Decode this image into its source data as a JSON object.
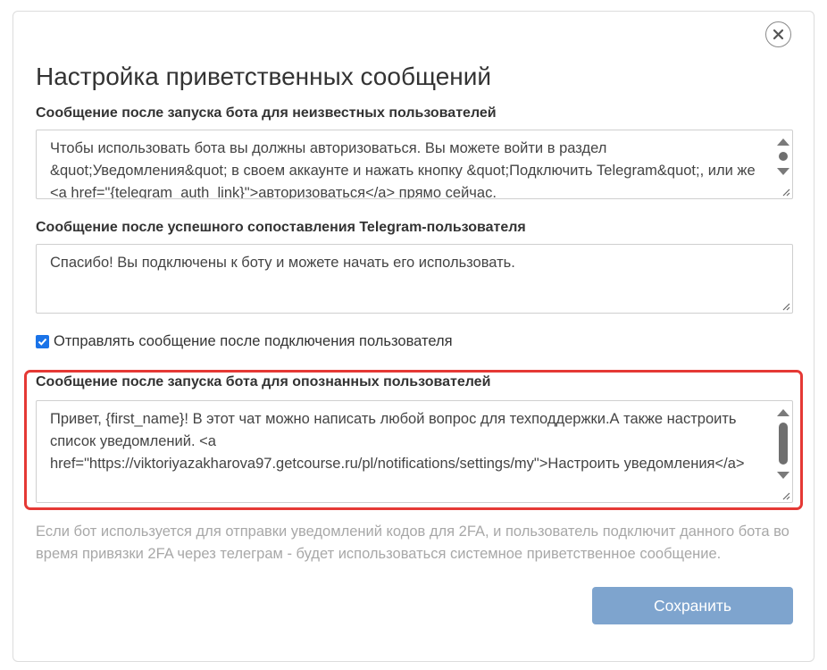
{
  "dialog": {
    "title": "Настройка приветственных сообщений",
    "close_icon": "close-icon"
  },
  "unknown_users": {
    "label": "Сообщение после запуска бота для неизвестных пользователей",
    "value": "Чтобы использовать бота вы должны авторизоваться. Вы можете войти в раздел &quot;Уведомления&quot; в своем аккаунте и нажать кнопку &quot;Подключить Telegram&quot;, или же <a href=\"{telegram_auth_link}\">авторизоваться</a> прямо сейчас."
  },
  "success_match": {
    "label": "Сообщение после успешного сопоставления Telegram-пользователя",
    "value": "Спасибо! Вы подключены к боту и можете начать его использовать."
  },
  "send_after_connect": {
    "checked": true,
    "label": "Отправлять сообщение после подключения пользователя"
  },
  "known_users": {
    "label": "Сообщение после запуска бота для опознанных пользователей",
    "value": "Привет, {first_name}! В этот чат можно написать любой вопрос для техподдержки.А также настроить список уведомлений. <a href=\"https://viktoriyazakharova97.getcourse.ru/pl/notifications/settings/my\">Настроить уведомления</a>"
  },
  "hint": "Если бот используется для отправки уведомлений кодов для 2FA, и пользователь подключит данного бота во время привязки 2FA через телеграм - будет использоваться системное приветственное сообщение.",
  "save_button": "Сохранить",
  "colors": {
    "accent": "#1a73e8",
    "save_button": "#7ea4ce",
    "highlight": "#e53935",
    "hint_text": "#a8a8a8"
  }
}
